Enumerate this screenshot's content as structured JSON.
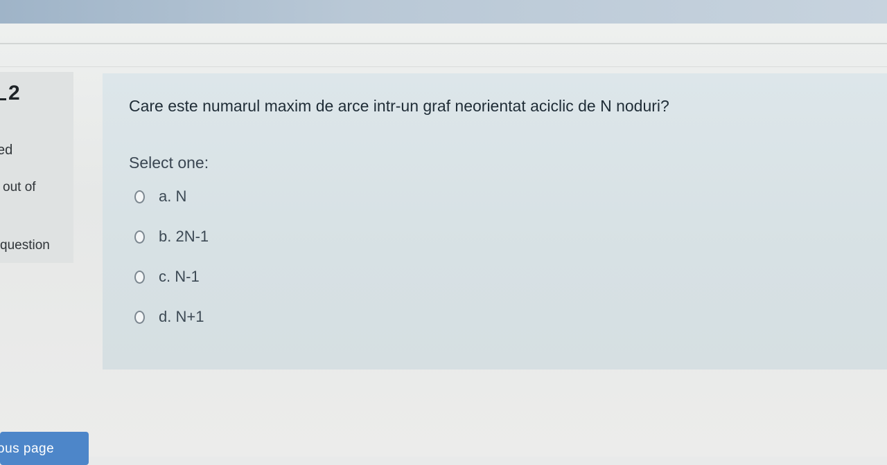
{
  "info": {
    "question_number": "2",
    "state_fragment": "ed",
    "mark_fragment": "out of",
    "flag_fragment": "question"
  },
  "question": {
    "text": "Care este numarul maxim de arce intr-un graf neorientat aciclic de N noduri?",
    "prompt": "Select one:",
    "options": [
      {
        "label": "a. N",
        "selected": false
      },
      {
        "label": "b. 2N-1",
        "selected": false
      },
      {
        "label": "c. N-1",
        "selected": false
      },
      {
        "label": "d. N+1",
        "selected": false
      }
    ]
  },
  "navigation": {
    "previous_fragment": "ous page"
  },
  "colors": {
    "panel": "#dde6ea",
    "info_block": "#dfe2e2",
    "button": "#4d86c9"
  }
}
